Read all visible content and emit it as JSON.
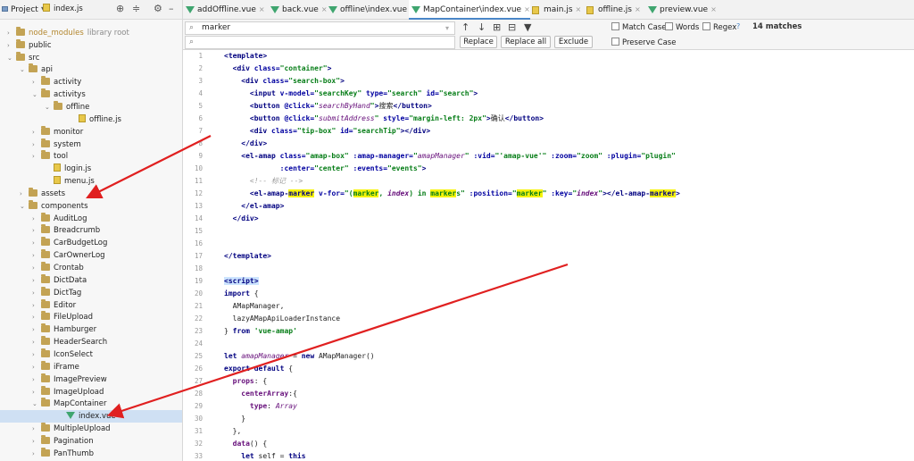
{
  "sidebar": {
    "title": "Project",
    "dropdown": "▾",
    "tree": [
      {
        "label": "index.js",
        "kind": "js",
        "indent": 38,
        "arrow": "",
        "cut": true
      },
      {
        "label": "node_modules",
        "muted": "library root",
        "kind": "folder",
        "indent": 8,
        "arrow": "›",
        "nm": true
      },
      {
        "label": "public",
        "kind": "folder",
        "indent": 8,
        "arrow": "›"
      },
      {
        "label": "src",
        "kind": "folder",
        "indent": 8,
        "arrow": "⌄"
      },
      {
        "label": "api",
        "kind": "folder",
        "indent": 22,
        "arrow": "⌄"
      },
      {
        "label": "activity",
        "kind": "folder",
        "indent": 36,
        "arrow": "›"
      },
      {
        "label": "activitys",
        "kind": "folder",
        "indent": 36,
        "arrow": "⌄"
      },
      {
        "label": "offline",
        "kind": "folder",
        "indent": 50,
        "arrow": "⌄"
      },
      {
        "label": "offline.js",
        "kind": "js",
        "indent": 78,
        "arrow": ""
      },
      {
        "label": "monitor",
        "kind": "folder",
        "indent": 36,
        "arrow": "›"
      },
      {
        "label": "system",
        "kind": "folder",
        "indent": 36,
        "arrow": "›"
      },
      {
        "label": "tool",
        "kind": "folder",
        "indent": 36,
        "arrow": "›"
      },
      {
        "label": "login.js",
        "kind": "js",
        "indent": 50,
        "arrow": ""
      },
      {
        "label": "menu.js",
        "kind": "js",
        "indent": 50,
        "arrow": ""
      },
      {
        "label": "assets",
        "kind": "folder",
        "indent": 22,
        "arrow": "›"
      },
      {
        "label": "components",
        "kind": "folder",
        "indent": 22,
        "arrow": "⌄"
      },
      {
        "label": "AuditLog",
        "kind": "folder",
        "indent": 36,
        "arrow": "›"
      },
      {
        "label": "Breadcrumb",
        "kind": "folder",
        "indent": 36,
        "arrow": "›"
      },
      {
        "label": "CarBudgetLog",
        "kind": "folder",
        "indent": 36,
        "arrow": "›"
      },
      {
        "label": "CarOwnerLog",
        "kind": "folder",
        "indent": 36,
        "arrow": "›"
      },
      {
        "label": "Crontab",
        "kind": "folder",
        "indent": 36,
        "arrow": "›"
      },
      {
        "label": "DictData",
        "kind": "folder",
        "indent": 36,
        "arrow": "›"
      },
      {
        "label": "DictTag",
        "kind": "folder",
        "indent": 36,
        "arrow": "›"
      },
      {
        "label": "Editor",
        "kind": "folder",
        "indent": 36,
        "arrow": "›"
      },
      {
        "label": "FileUpload",
        "kind": "folder",
        "indent": 36,
        "arrow": "›"
      },
      {
        "label": "Hamburger",
        "kind": "folder",
        "indent": 36,
        "arrow": "›"
      },
      {
        "label": "HeaderSearch",
        "kind": "folder",
        "indent": 36,
        "arrow": "›"
      },
      {
        "label": "IconSelect",
        "kind": "folder",
        "indent": 36,
        "arrow": "›"
      },
      {
        "label": "iFrame",
        "kind": "folder",
        "indent": 36,
        "arrow": "›"
      },
      {
        "label": "ImagePreview",
        "kind": "folder",
        "indent": 36,
        "arrow": "›"
      },
      {
        "label": "ImageUpload",
        "kind": "folder",
        "indent": 36,
        "arrow": "›"
      },
      {
        "label": "MapContainer",
        "kind": "folder",
        "indent": 36,
        "arrow": "⌄"
      },
      {
        "label": "index.vue",
        "kind": "vue",
        "indent": 64,
        "arrow": "",
        "selected": true
      },
      {
        "label": "MultipleUpload",
        "kind": "folder",
        "indent": 36,
        "arrow": "›"
      },
      {
        "label": "Pagination",
        "kind": "folder",
        "indent": 36,
        "arrow": "›"
      },
      {
        "label": "PanThumb",
        "kind": "folder",
        "indent": 36,
        "arrow": "›"
      }
    ]
  },
  "tabs": [
    {
      "label": "addOffline.vue",
      "kind": "vue"
    },
    {
      "label": "back.vue",
      "kind": "vue"
    },
    {
      "label": "offline\\index.vue",
      "kind": "vue"
    },
    {
      "label": "MapContainer\\index.vue",
      "kind": "vue",
      "active": true
    },
    {
      "label": "main.js",
      "kind": "js"
    },
    {
      "label": "offline.js",
      "kind": "js"
    },
    {
      "label": "preview.vue",
      "kind": "vue"
    }
  ],
  "find": {
    "search_value": "marker",
    "replace_value": "",
    "replace_label": "Replace",
    "replace_all_label": "Replace all",
    "exclude_label": "Exclude",
    "match_case_label": "Match Case",
    "words_label": "Words",
    "regex_label": "Regex",
    "regex_help": "?",
    "preserve_case_label": "Preserve Case",
    "matches": "14 matches"
  },
  "editor": {
    "line_numbers": [
      "1",
      "2",
      "3",
      "4",
      "5",
      "6",
      "7",
      "8",
      "9",
      "10",
      "11",
      "12",
      "13",
      "14",
      "15",
      "16",
      "17",
      "18",
      "19",
      "20",
      "21",
      "22",
      "23",
      "24",
      "25",
      "26",
      "27",
      "28",
      "29",
      "30",
      "31",
      "32",
      "33"
    ]
  },
  "colors": {
    "search_highlight": "#f7f40a",
    "tag": "#000080",
    "string": "#067d17",
    "arrow": "#e02020",
    "active_tab_underline": "#4a86c8"
  }
}
